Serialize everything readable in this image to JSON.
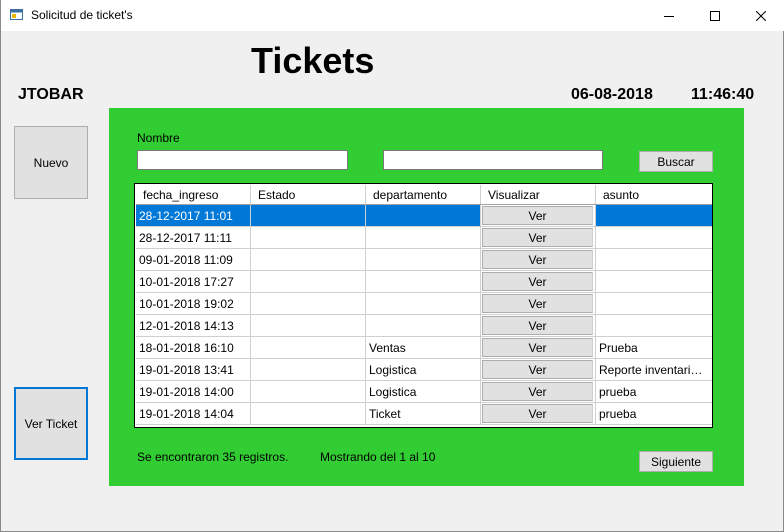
{
  "window": {
    "title": "Solicitud de ticket's"
  },
  "header": {
    "heading": "Tickets",
    "user": "JTOBAR",
    "date": "06-08-2018",
    "time": "11:46:40"
  },
  "sidebar": {
    "new_label": "Nuevo",
    "view_label": "Ver Ticket"
  },
  "filters": {
    "name_label": "Nombre",
    "name_value": "",
    "second_value": "",
    "search_label": "Buscar"
  },
  "table": {
    "columns": [
      "fecha_ingreso",
      "Estado",
      "departamento",
      "Visualizar",
      "asunto"
    ],
    "rows": [
      {
        "fecha": "28-12-2017 11:01",
        "estado": "",
        "departamento": "",
        "ver": "Ver",
        "asunto": ""
      },
      {
        "fecha": "28-12-2017 11:11",
        "estado": "",
        "departamento": "",
        "ver": "Ver",
        "asunto": ""
      },
      {
        "fecha": "09-01-2018 11:09",
        "estado": "",
        "departamento": "",
        "ver": "Ver",
        "asunto": ""
      },
      {
        "fecha": "10-01-2018 17:27",
        "estado": "",
        "departamento": "",
        "ver": "Ver",
        "asunto": ""
      },
      {
        "fecha": "10-01-2018 19:02",
        "estado": "",
        "departamento": "",
        "ver": "Ver",
        "asunto": ""
      },
      {
        "fecha": "12-01-2018 14:13",
        "estado": "",
        "departamento": "",
        "ver": "Ver",
        "asunto": ""
      },
      {
        "fecha": "18-01-2018 16:10",
        "estado": "",
        "departamento": "Ventas",
        "ver": "Ver",
        "asunto": "Prueba"
      },
      {
        "fecha": "19-01-2018 13:41",
        "estado": "",
        "departamento": "Logistica",
        "ver": "Ver",
        "asunto": "Reporte inventario pr..."
      },
      {
        "fecha": "19-01-2018 14:00",
        "estado": "",
        "departamento": "Logistica",
        "ver": "Ver",
        "asunto": "prueba"
      },
      {
        "fecha": "19-01-2018 14:04",
        "estado": "",
        "departamento": "Ticket",
        "ver": "Ver",
        "asunto": "prueba"
      }
    ]
  },
  "footer": {
    "records_text": "Se encontraron 35 registros.",
    "showing_text": "Mostrando del 1 al 10",
    "next_label": "Siguiente"
  },
  "colors": {
    "panel": "#32cd32",
    "selection": "#0078d7"
  }
}
